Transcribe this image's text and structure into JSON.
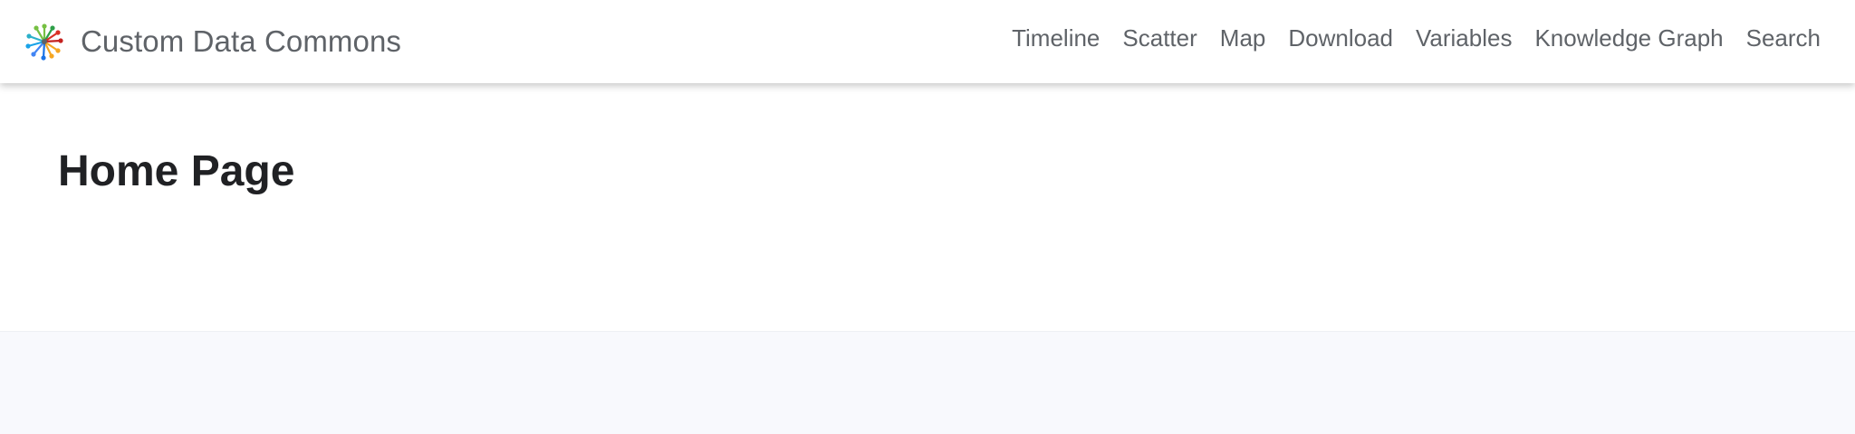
{
  "header": {
    "brand_name": "Custom Data Commons",
    "logo_icon": "data-commons-logo-icon",
    "nav": [
      {
        "label": "Timeline"
      },
      {
        "label": "Scatter"
      },
      {
        "label": "Map"
      },
      {
        "label": "Download"
      },
      {
        "label": "Variables"
      },
      {
        "label": "Knowledge Graph"
      },
      {
        "label": "Search"
      }
    ]
  },
  "main": {
    "title": "Home Page"
  },
  "colors": {
    "nav_text": "#5f6368",
    "title_text": "#202124",
    "footer_bg": "#f8f9fd"
  }
}
